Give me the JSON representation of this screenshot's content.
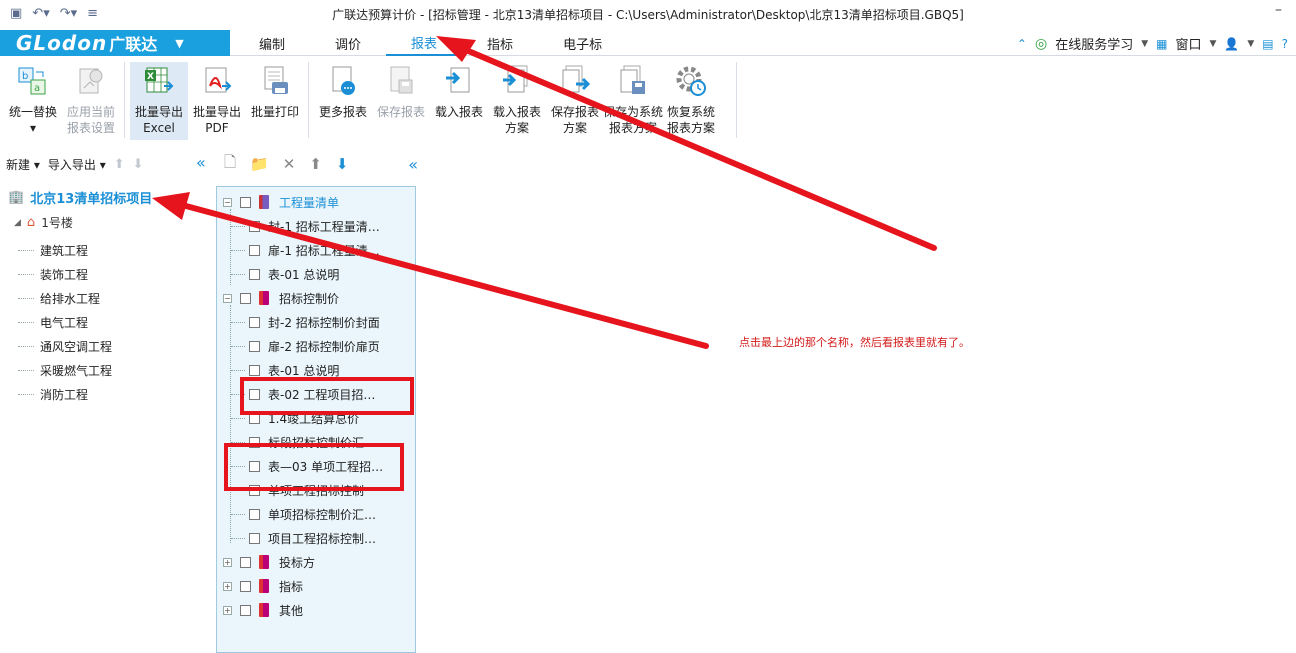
{
  "window": {
    "title": "广联达预算计价 - [招标管理 - 北京13清单招标项目 - C:\\Users\\Administrator\\Desktop\\北京13清单招标项目.GBQ5]",
    "minimize": "–"
  },
  "quick_access": {
    "save_icon": "save-icon",
    "undo_icon": "undo-icon",
    "redo_icon": "redo-icon",
    "customize_icon": "customize-icon"
  },
  "brand": {
    "name": "GLodon",
    "cn": "广联达",
    "caret": "▼"
  },
  "menu": {
    "tabs": [
      {
        "label": "编制"
      },
      {
        "label": "调价"
      },
      {
        "label": "报表"
      },
      {
        "label": "指标"
      },
      {
        "label": "电子标"
      }
    ],
    "active": "报表",
    "right": {
      "collapse_icon": "⌃",
      "online_label": "在线服务学习",
      "window_label": "窗口",
      "user_icon": "user-icon",
      "msg_icon": "message-icon",
      "help": "?"
    }
  },
  "ribbon": {
    "buttons": [
      {
        "label1": "统一替换",
        "label2": "▾",
        "disabled": false
      },
      {
        "label1": "应用当前",
        "label2": "报表设置",
        "disabled": true
      },
      {
        "label1": "批量导出",
        "label2": "Excel",
        "disabled": false
      },
      {
        "label1": "批量导出",
        "label2": "PDF",
        "disabled": false
      },
      {
        "label1": "批量打印",
        "label2": "",
        "disabled": false
      },
      {
        "label1": "更多报表",
        "label2": "",
        "disabled": false
      },
      {
        "label1": "保存报表",
        "label2": "",
        "disabled": true
      },
      {
        "label1": "载入报表",
        "label2": "",
        "disabled": false
      },
      {
        "label1": "载入报表",
        "label2": "方案",
        "disabled": false
      },
      {
        "label1": "保存报表",
        "label2": "方案",
        "disabled": false
      },
      {
        "label1": "保存为系统",
        "label2": "报表方案",
        "disabled": false
      },
      {
        "label1": "恢复系统",
        "label2": "报表方案",
        "disabled": false
      }
    ]
  },
  "left_panel": {
    "new_label": "新建",
    "import_export_label": "导入导出",
    "project_name": "北京13清单招标项目",
    "building": "1号楼",
    "items": [
      "建筑工程",
      "装饰工程",
      "给排水工程",
      "电气工程",
      "通风空调工程",
      "采暖燃气工程",
      "消防工程"
    ]
  },
  "report_tree": {
    "groups": [
      {
        "title": "工程量清单",
        "expanded": true,
        "items": [
          "封-1 招标工程量清…",
          "扉-1 招标工程量清…",
          "表-01 总说明"
        ]
      },
      {
        "title": "招标控制价",
        "expanded": true,
        "items": [
          "封-2 招标控制价封面",
          "扉-2 招标控制价扉页",
          "表-01 总说明",
          "表-02 工程项目招…",
          "1.4竣工结算总价",
          "标段招标控制价汇…",
          "表—03 单项工程招…",
          "单项工程招标控制",
          "单项招标控制价汇…",
          "项目工程招标控制…"
        ]
      },
      {
        "title": "投标方",
        "expanded": false,
        "items": []
      },
      {
        "title": "指标",
        "expanded": false,
        "items": []
      },
      {
        "title": "其他",
        "expanded": false,
        "items": []
      }
    ]
  },
  "annotation": {
    "text": "点击最上边的那个名称，然后看报表里就有了。",
    "color": "#e6141c"
  },
  "colors": {
    "brand": "#1aa0de",
    "accent": "#1a8fd6",
    "tree_bg": "#eaf6fb"
  }
}
